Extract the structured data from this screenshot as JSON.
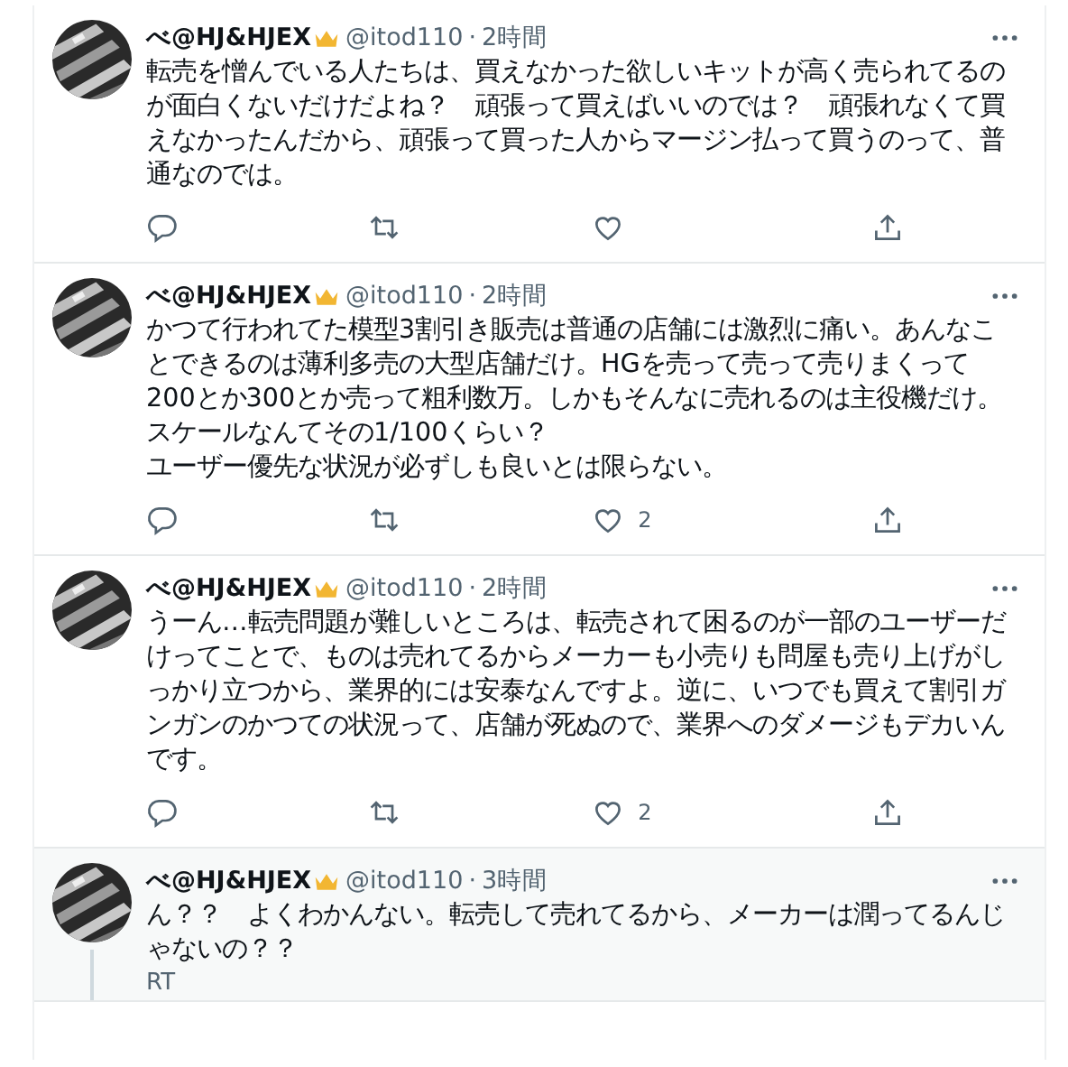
{
  "tweets": [
    {
      "name": "べ@HJ&HJEX",
      "handle": "@itod110",
      "separator": "·",
      "time": "2時間",
      "paragraphs": [
        "転売を憎んでいる人たちは、買えなかった欲しいキットが高く売られてるのが面白くないだけだよね？　頑張って買えばいいのでは？　頑張れなくて買えなかったんだから、頑張って買った人からマージン払って買うのって、普通なのでは。"
      ],
      "highlighted": false,
      "thread": false
    },
    {
      "name": "べ@HJ&HJEX",
      "handle": "@itod110",
      "separator": "·",
      "time": "2時間",
      "paragraphs": [
        "かつて行われてた模型3割引き販売は普通の店舗には激烈に痛い。あんなことできるのは薄利多売の大型店舗だけ。HGを売って売って売りまくって200とか300とか売って粗利数万。しかもそんなに売れるのは主役機だけ。",
        "スケールなんてその1/100くらい？",
        "ユーザー優先な状況が必ずしも良いとは限らない。"
      ],
      "like_count": "2",
      "highlighted": false,
      "thread": false
    },
    {
      "name": "べ@HJ&HJEX",
      "handle": "@itod110",
      "separator": "·",
      "time": "2時間",
      "paragraphs": [
        "うーん…転売問題が難しいところは、転売されて困るのが一部のユーザーだけってことで、ものは売れてるからメーカーも小売りも問屋も売り上げがしっかり立つから、業界的には安泰なんですよ。逆に、いつでも買えて割引ガンガンのかつての状況って、店舗が死ぬので、業界へのダメージもデカいんです。"
      ],
      "like_count": "2",
      "highlighted": false,
      "thread": false
    },
    {
      "name": "べ@HJ&HJEX",
      "handle": "@itod110",
      "separator": "·",
      "time": "3時間",
      "paragraphs": [
        "ん？？　よくわかんない。転売して売れてるから、メーカーは潤ってるんじゃないの？？"
      ],
      "extra": "RT",
      "highlighted": true,
      "thread": true
    }
  ]
}
